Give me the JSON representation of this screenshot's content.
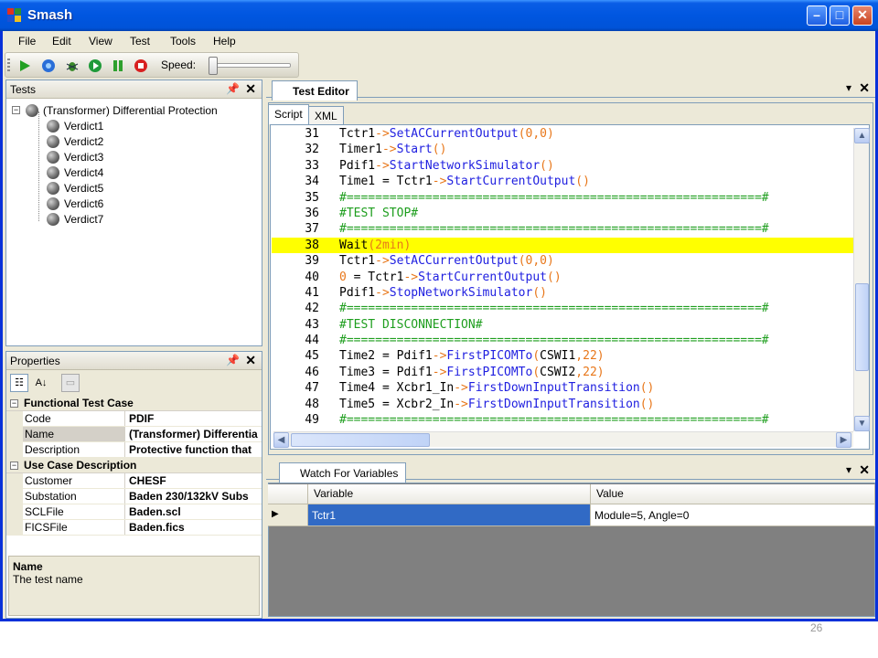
{
  "window": {
    "title": "Smash"
  },
  "menu": [
    "File",
    "Edit",
    "View",
    "Test",
    "Tools",
    "Help"
  ],
  "toolbar": {
    "speed_label": "Speed:",
    "speed_level": 0
  },
  "tests_pane": {
    "title": "Tests",
    "root": "(Transformer) Differential Protection",
    "children": [
      "Verdict1",
      "Verdict2",
      "Verdict3",
      "Verdict4",
      "Verdict5",
      "Verdict6",
      "Verdict7"
    ]
  },
  "properties_pane": {
    "title": "Properties",
    "categories": [
      {
        "name": "Functional Test Case",
        "rows": [
          {
            "name": "Code",
            "value": "PDIF"
          },
          {
            "name": "Name",
            "value": "(Transformer) Differentia"
          },
          {
            "name": "Description",
            "value": "Protective function that"
          }
        ]
      },
      {
        "name": "Use Case Description",
        "rows": [
          {
            "name": "Customer",
            "value": "CHESF"
          },
          {
            "name": "Substation",
            "value": "Baden 230/132kV Subs"
          },
          {
            "name": "SCLFile",
            "value": "Baden.scl"
          },
          {
            "name": "FICSFile",
            "value": "Baden.fics"
          }
        ]
      }
    ],
    "description_title": "Name",
    "description_text": "The test name"
  },
  "editor": {
    "tab": "Test Editor",
    "sub_tabs": [
      "Script",
      "XML"
    ],
    "highlight_line": 38,
    "lines": [
      {
        "n": "31",
        "tokens": [
          [
            "id",
            "Tctr1"
          ],
          [
            "op",
            "->"
          ],
          [
            "fn",
            "SetACCurrentOutput"
          ],
          [
            "arg",
            "(0,0)"
          ]
        ]
      },
      {
        "n": "32",
        "tokens": [
          [
            "id",
            "Timer1"
          ],
          [
            "op",
            "->"
          ],
          [
            "fn",
            "Start"
          ],
          [
            "arg",
            "()"
          ]
        ]
      },
      {
        "n": "33",
        "tokens": [
          [
            "id",
            "Pdif1"
          ],
          [
            "op",
            "->"
          ],
          [
            "fn",
            "StartNetworkSimulator"
          ],
          [
            "arg",
            "()"
          ]
        ]
      },
      {
        "n": "34",
        "tokens": [
          [
            "id",
            "Time1 = Tctr1"
          ],
          [
            "op",
            "->"
          ],
          [
            "fn",
            "StartCurrentOutput"
          ],
          [
            "arg",
            "()"
          ]
        ]
      },
      {
        "n": "35",
        "tokens": [
          [
            "cm",
            "#==========================================================#"
          ]
        ]
      },
      {
        "n": "36",
        "tokens": [
          [
            "cm",
            "#TEST STOP#"
          ]
        ]
      },
      {
        "n": "37",
        "tokens": [
          [
            "cm",
            "#==========================================================#"
          ]
        ]
      },
      {
        "n": "38",
        "tokens": [
          [
            "id",
            "Wait"
          ],
          [
            "arg",
            "(2min)"
          ]
        ]
      },
      {
        "n": "39",
        "tokens": [
          [
            "id",
            "Tctr1"
          ],
          [
            "op",
            "->"
          ],
          [
            "fn",
            "SetACCurrentOutput"
          ],
          [
            "arg",
            "(0,0)"
          ]
        ]
      },
      {
        "n": "40",
        "tokens": [
          [
            "arg",
            "0"
          ],
          [
            "id",
            " = Tctr1"
          ],
          [
            "op",
            "->"
          ],
          [
            "fn",
            "StartCurrentOutput"
          ],
          [
            "arg",
            "()"
          ]
        ]
      },
      {
        "n": "41",
        "tokens": [
          [
            "id",
            "Pdif1"
          ],
          [
            "op",
            "->"
          ],
          [
            "fn",
            "StopNetworkSimulator"
          ],
          [
            "arg",
            "()"
          ]
        ]
      },
      {
        "n": "42",
        "tokens": [
          [
            "cm",
            "#==========================================================#"
          ]
        ]
      },
      {
        "n": "43",
        "tokens": [
          [
            "cm",
            "#TEST DISCONNECTION#"
          ]
        ]
      },
      {
        "n": "44",
        "tokens": [
          [
            "cm",
            "#==========================================================#"
          ]
        ]
      },
      {
        "n": "45",
        "tokens": [
          [
            "id",
            "Time2 = Pdif1"
          ],
          [
            "op",
            "->"
          ],
          [
            "fn",
            "FirstPICOMTo"
          ],
          [
            "arg",
            "("
          ],
          [
            "id",
            "CSWI1"
          ],
          [
            "arg",
            ",22)"
          ]
        ]
      },
      {
        "n": "46",
        "tokens": [
          [
            "id",
            "Time3 = Pdif1"
          ],
          [
            "op",
            "->"
          ],
          [
            "fn",
            "FirstPICOMTo"
          ],
          [
            "arg",
            "("
          ],
          [
            "id",
            "CSWI2"
          ],
          [
            "arg",
            ",22)"
          ]
        ]
      },
      {
        "n": "47",
        "tokens": [
          [
            "id",
            "Time4 = Xcbr1_In"
          ],
          [
            "op",
            "->"
          ],
          [
            "fn",
            "FirstDownInputTransition"
          ],
          [
            "arg",
            "()"
          ]
        ]
      },
      {
        "n": "48",
        "tokens": [
          [
            "id",
            "Time5 = Xcbr2_In"
          ],
          [
            "op",
            "->"
          ],
          [
            "fn",
            "FirstDownInputTransition"
          ],
          [
            "arg",
            "()"
          ]
        ]
      },
      {
        "n": "49",
        "tokens": [
          [
            "cm",
            "#==========================================================#"
          ]
        ]
      }
    ]
  },
  "watch": {
    "tab": "Watch For Variables",
    "columns": [
      "Variable",
      "Value"
    ],
    "rows": [
      {
        "variable": "Tctr1",
        "value": "Module=5, Angle=0"
      }
    ]
  },
  "page_number": "26",
  "colors": {
    "highlight": "#ffff00",
    "selection": "#316ac5",
    "function": "#2020e0",
    "comment": "#1e9e1e",
    "operator": "#e8771a"
  }
}
